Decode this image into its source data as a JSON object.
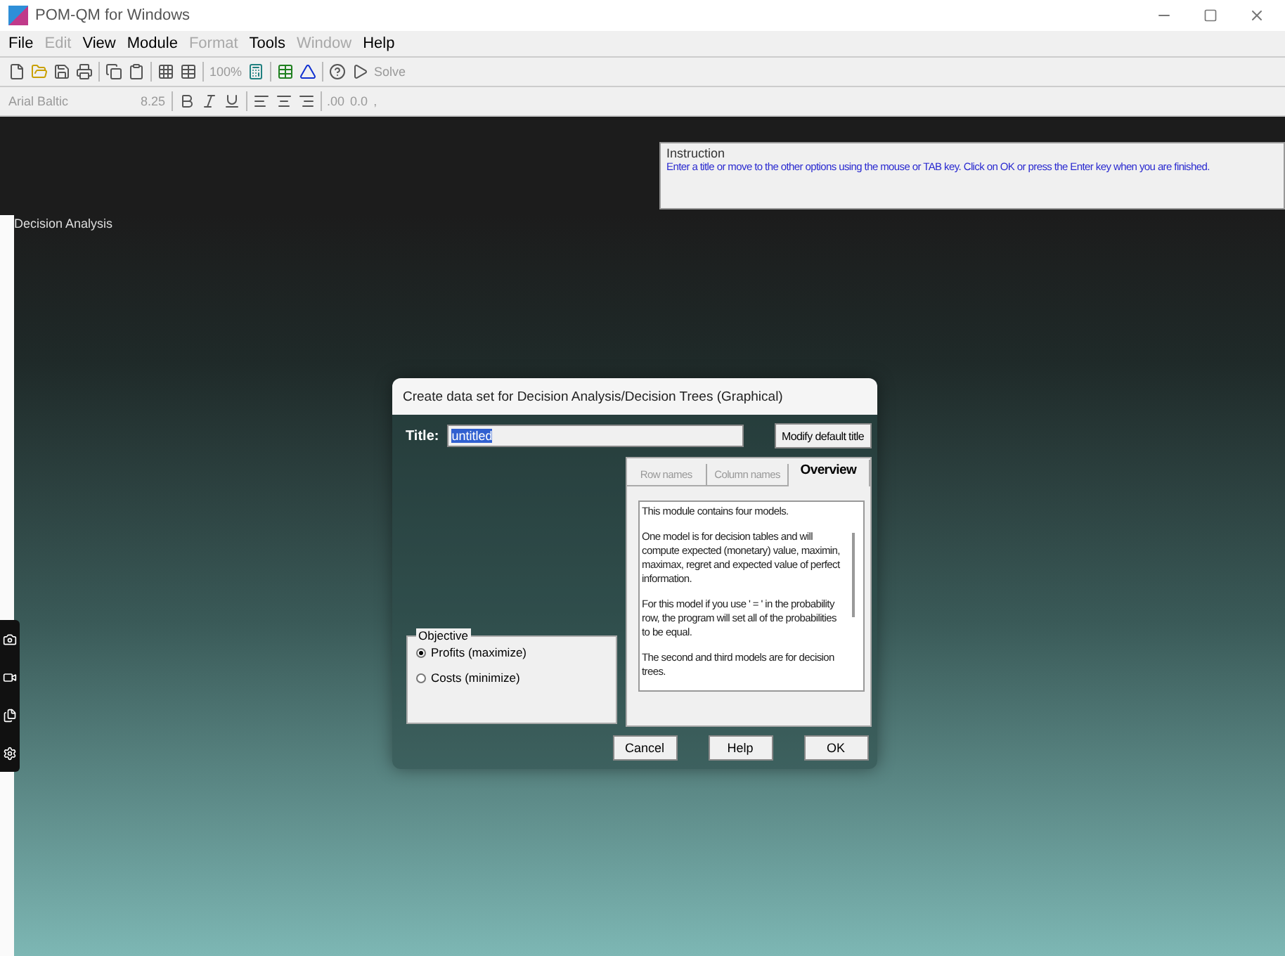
{
  "window": {
    "title": "POM-QM for Windows"
  },
  "menu": [
    {
      "label": "File",
      "disabled": false
    },
    {
      "label": "Edit",
      "disabled": true
    },
    {
      "label": "View",
      "disabled": false
    },
    {
      "label": "Module",
      "disabled": false
    },
    {
      "label": "Format",
      "disabled": true
    },
    {
      "label": "Tools",
      "disabled": false
    },
    {
      "label": "Window",
      "disabled": true
    },
    {
      "label": "Help",
      "disabled": false
    }
  ],
  "toolbar": {
    "zoom": "100%",
    "solve": "Solve"
  },
  "format_bar": {
    "font": "Arial Baltic",
    "size": "8.25",
    "decimals": ".00",
    "number": "0.0",
    "comma": ","
  },
  "instruction": {
    "label": "Instruction",
    "text": "Enter a title or move to the other options using the mouse or TAB key. Click on OK or press the Enter key when you are finished."
  },
  "document": {
    "title": "Decision Analysis"
  },
  "dialog": {
    "title": "Create data set for Decision Analysis/Decision Trees (Graphical)",
    "title_label": "Title:",
    "title_value": "untitled",
    "modify_button": "Modify default title",
    "tabs": [
      {
        "label": "Row names",
        "selected": false
      },
      {
        "label": "Column names",
        "selected": false
      },
      {
        "label": "Overview",
        "selected": true
      }
    ],
    "overview": [
      "This module contains four models.",
      "One model is for decision tables and will compute expected (monetary) value, maximin, maximax, regret and expected value of perfect information.",
      "For this model if you use ' = ' in the probability row, the program will set all of the probabilities to be equal.",
      "The second and third models are for decision trees."
    ],
    "objective": {
      "label": "Objective",
      "options": [
        {
          "label": "Profits (maximize)",
          "selected": true
        },
        {
          "label": "Costs (minimize)",
          "selected": false
        }
      ]
    },
    "buttons": [
      "Cancel",
      "Help",
      "OK"
    ]
  }
}
